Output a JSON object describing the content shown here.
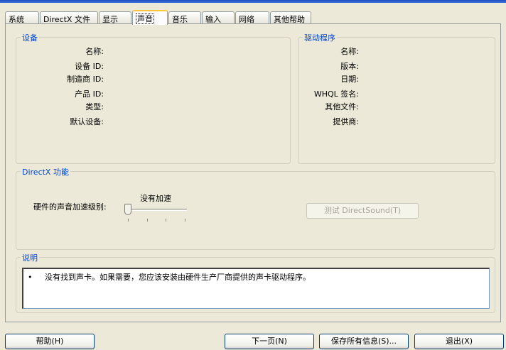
{
  "tabs": [
    {
      "label": "系统",
      "active": false
    },
    {
      "label": "DirectX 文件",
      "active": false
    },
    {
      "label": "显示",
      "active": false
    },
    {
      "label": "声音",
      "active": true
    },
    {
      "label": "音乐",
      "active": false
    },
    {
      "label": "输入",
      "active": false
    },
    {
      "label": "网络",
      "active": false
    },
    {
      "label": "其他帮助",
      "active": false
    }
  ],
  "device": {
    "legend": "设备",
    "fields": [
      "名称:",
      "设备 ID:",
      "制造商 ID:",
      "产品 ID:",
      "类型:",
      "默认设备:"
    ]
  },
  "driver": {
    "legend": "驱动程序",
    "fields": [
      "名称:",
      "版本:",
      "日期:",
      "WHQL 签名:",
      "其他文件:",
      "提供商:"
    ]
  },
  "directx": {
    "legend": "DirectX 功能",
    "accel_label": "硬件的声音加速级别:",
    "accel_value": "没有加速",
    "accel_level": 0,
    "test_button": "测试 DirectSound(T)"
  },
  "notes": {
    "legend": "说明",
    "bullet": "•",
    "text": "没有找到声卡。如果需要，您应该安装由硬件生产厂商提供的声卡驱动程序。"
  },
  "buttons": {
    "help": "帮助(H)",
    "next": "下一页(N)",
    "save": "保存所有信息(S)...",
    "exit": "退出(X)"
  }
}
